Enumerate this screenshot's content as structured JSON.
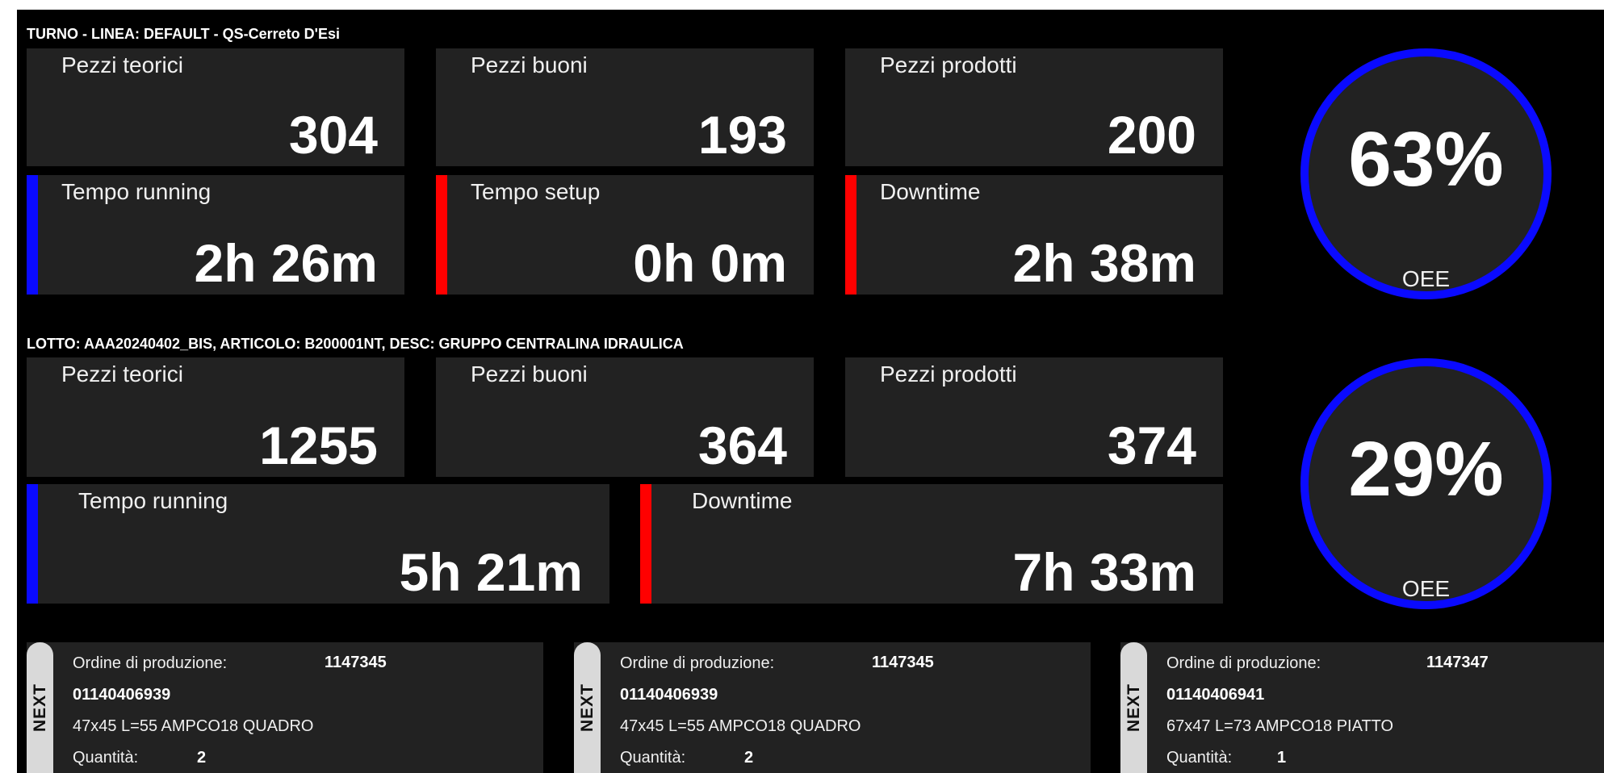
{
  "colors": {
    "running": "#0a0aff",
    "stop": "#ff0000",
    "panel": "#222222",
    "background": "#000000"
  },
  "shift": {
    "title": "TURNO - LINEA: DEFAULT - QS-Cerreto D'Esi",
    "cards": [
      {
        "label": "Pezzi teorici",
        "value": "304"
      },
      {
        "label": "Pezzi buoni",
        "value": "193"
      },
      {
        "label": "Pezzi prodotti",
        "value": "200"
      },
      {
        "label": "Tempo running",
        "value": "2h 26m"
      },
      {
        "label": "Tempo setup",
        "value": "0h 0m"
      },
      {
        "label": "Downtime",
        "value": "2h 38m"
      }
    ],
    "oee": {
      "value": "63%",
      "caption": "OEE"
    }
  },
  "lot": {
    "title": "LOTTO: AAA20240402_BIS, ARTICOLO: B200001NT, DESC: GRUPPO CENTRALINA IDRAULICA",
    "cards": [
      {
        "label": "Pezzi teorici",
        "value": "1255"
      },
      {
        "label": "Pezzi buoni",
        "value": "364"
      },
      {
        "label": "Pezzi prodotti",
        "value": "374"
      },
      {
        "label": "Tempo running",
        "value": "5h 21m"
      },
      {
        "label": "Downtime",
        "value": "7h 33m"
      }
    ],
    "oee": {
      "value": "29%",
      "caption": "OEE"
    }
  },
  "orders": [
    {
      "tab": "NEXT",
      "order_label": "Ordine di produzione:",
      "order_number": "1147345",
      "code": "01140406939",
      "description": "47x45 L=55 AMPCO18 QUADRO",
      "qty_label": "Quantità:",
      "qty": "2"
    },
    {
      "tab": "NEXT",
      "order_label": "Ordine di produzione:",
      "order_number": "1147345",
      "code": "01140406939",
      "description": "47x45 L=55 AMPCO18 QUADRO",
      "qty_label": "Quantità:",
      "qty": "2"
    },
    {
      "tab": "NEXT",
      "order_label": "Ordine di produzione:",
      "order_number": "1147347",
      "code": "01140406941",
      "description": "67x47 L=73 AMPCO18 PIATTO",
      "qty_label": "Quantità:",
      "qty": "1"
    }
  ]
}
